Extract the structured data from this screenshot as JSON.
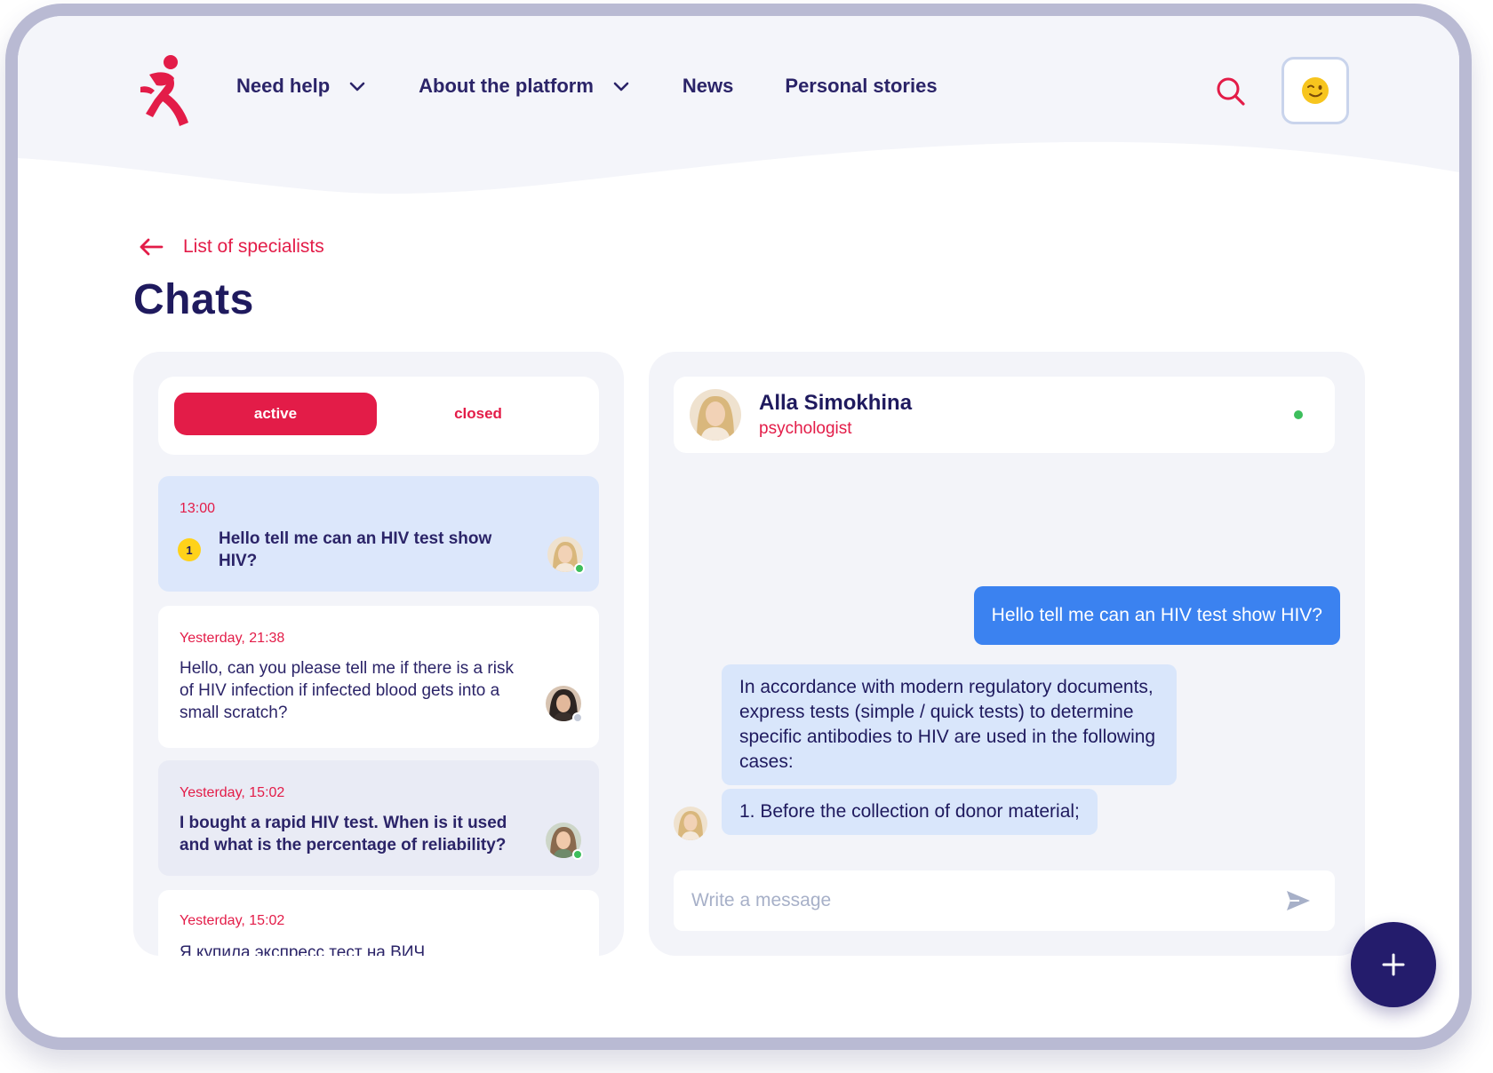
{
  "header": {
    "nav": [
      {
        "label": "Need help",
        "has_dropdown": true
      },
      {
        "label": "About the platform",
        "has_dropdown": true
      },
      {
        "label": "News",
        "has_dropdown": false
      },
      {
        "label": "Personal stories",
        "has_dropdown": false
      }
    ],
    "search_icon": "search-icon",
    "profile_emoji": "😉"
  },
  "breadcrumb": {
    "label": "List of specialists"
  },
  "page": {
    "title": "Chats"
  },
  "tabs": {
    "active_label": "active",
    "closed_label": "closed",
    "selected": "active"
  },
  "chats": [
    {
      "time": "13:00",
      "text": "Hello tell me can an HIV test show HIV?",
      "unread": "1",
      "online": true,
      "bold": true
    },
    {
      "time": "Yesterday, 21:38",
      "text": "Hello, can you please tell me if there is a risk of HIV infection if infected blood gets into a small scratch?",
      "online": false,
      "bold": false
    },
    {
      "time": "Yesterday, 15:02",
      "text": "I bought a rapid HIV test. When is it used and what is the percentage of reliability?",
      "online": true,
      "bold": true
    },
    {
      "time": "Yesterday, 15:02",
      "text": "Я купила экспресс тест на ВИЧ",
      "online": false,
      "bold": false
    }
  ],
  "conversation": {
    "name": "Alla Simokhina",
    "role": "psychologist",
    "online": true,
    "messages": [
      {
        "from": "me",
        "text": "Hello tell me can an HIV test show HIV?"
      },
      {
        "from": "specialist",
        "text": "In accordance with modern regulatory documents, express tests (simple / quick tests) to determine specific antibodies to HIV are used in the following cases:"
      },
      {
        "from": "specialist",
        "text": "1. Before the collection of donor material;"
      }
    ],
    "composer_placeholder": "Write a message"
  },
  "colors": {
    "accent": "#e31c48",
    "navy": "#1f1a5e",
    "bubble_out": "#3b82f0",
    "bubble_in": "#d9e6fb",
    "online": "#3dbe5c",
    "badge": "#ffd21a"
  }
}
